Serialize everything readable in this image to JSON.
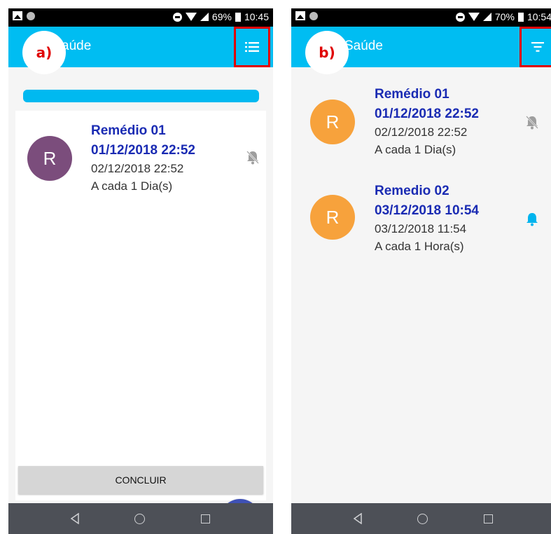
{
  "screen_a": {
    "panel_label": "a)",
    "status_bar": {
      "battery": "69%",
      "time": "10:45"
    },
    "app_bar": {
      "title": "aúde",
      "action_icon": "list-icon"
    },
    "progress_bar": {
      "color": "#00b9f0",
      "fraction": 1.0
    },
    "items": [
      {
        "avatar_letter": "R",
        "avatar_color": "#7b4d7c",
        "title": "Remédio 01",
        "time": "01/12/2018 22:52",
        "next": "02/12/2018 22:52",
        "frequency": "A cada 1 Dia(s)",
        "bell": "bell-off-icon"
      }
    ],
    "fab_icon": "+",
    "button_label": "CONCLUIR"
  },
  "screen_b": {
    "panel_label": "b)",
    "status_bar": {
      "battery": "70%",
      "time": "10:54"
    },
    "app_bar": {
      "title": "Saúde",
      "action_icon": "filter-icon"
    },
    "items": [
      {
        "avatar_letter": "R",
        "avatar_color": "#f7a23c",
        "title": "Remédio 01",
        "time": "01/12/2018 22:52",
        "next": "02/12/2018 22:52",
        "frequency": "A cada 1 Dia(s)",
        "bell": "bell-off-icon"
      },
      {
        "avatar_letter": "R",
        "avatar_color": "#f7a23c",
        "title": "Remedio 02",
        "time": "03/12/2018 10:54",
        "next": "03/12/2018 11:54",
        "frequency": "A cada 1 Hora(s)",
        "bell": "bell-on-icon"
      }
    ]
  },
  "colors": {
    "app_bar": "#00bdf2",
    "highlight_box": "#e00000",
    "title_text": "#1a2bb3",
    "fab": "#3f51b5",
    "bell_active": "#00b4ee",
    "bell_muted": "#9e9e9e",
    "nav_bar": "#4d5057"
  }
}
